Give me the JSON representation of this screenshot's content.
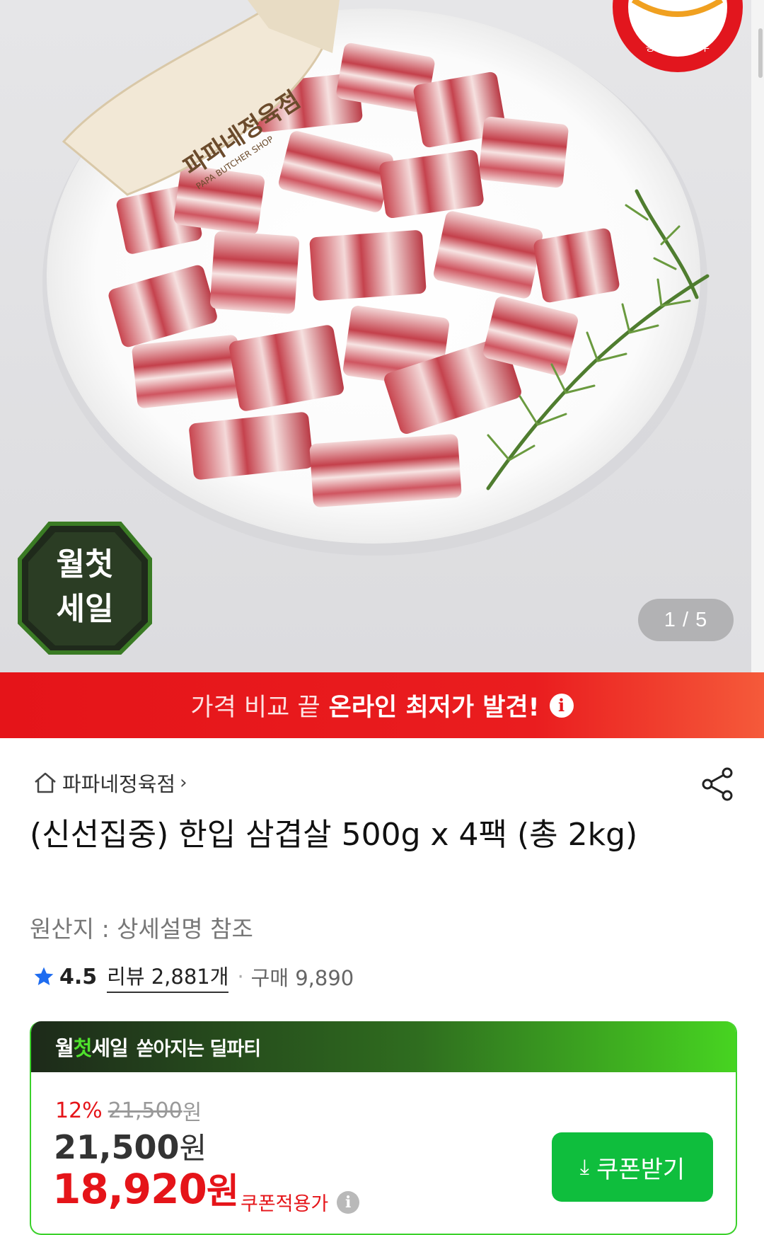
{
  "hero": {
    "slide_counter": "1 / 5",
    "sale_badge_line1": "월첫",
    "sale_badge_line2": "세일",
    "logo_text_main": "파파네정육점",
    "logo_text_sub": "PAPA BUTCHER SHOP",
    "cert_text": "농림축산식품부"
  },
  "price_banner": {
    "light_text": "가격 비교 끝",
    "bold_text": "온라인 최저가 발견!",
    "info_icon": "i"
  },
  "product": {
    "store_name": "파파네정육점",
    "title": "(신선집중) 한입 삼겹살 500g x 4팩 (총 2kg)",
    "origin": "원산지 : 상세설명 참조",
    "rating": "4.5",
    "review_label": "리뷰 2,881개",
    "purchase_label": "구매 9,890"
  },
  "deal": {
    "header_brand_a": "월",
    "header_brand_b": "첫",
    "header_brand_c": "세일",
    "header_tagline": "쏟아지는 딜파티",
    "discount_pct": "12%",
    "original_price": "21,500",
    "original_won": "원",
    "sale_price": "21,500",
    "sale_won": "원",
    "coupon_price": "18,920",
    "coupon_won": "원",
    "coupon_label": "쿠폰적용가",
    "coupon_button": "쿠폰받기"
  },
  "colors": {
    "banner_red": "#e51419",
    "deal_green": "#0fbe3d",
    "price_red": "#e51419"
  }
}
